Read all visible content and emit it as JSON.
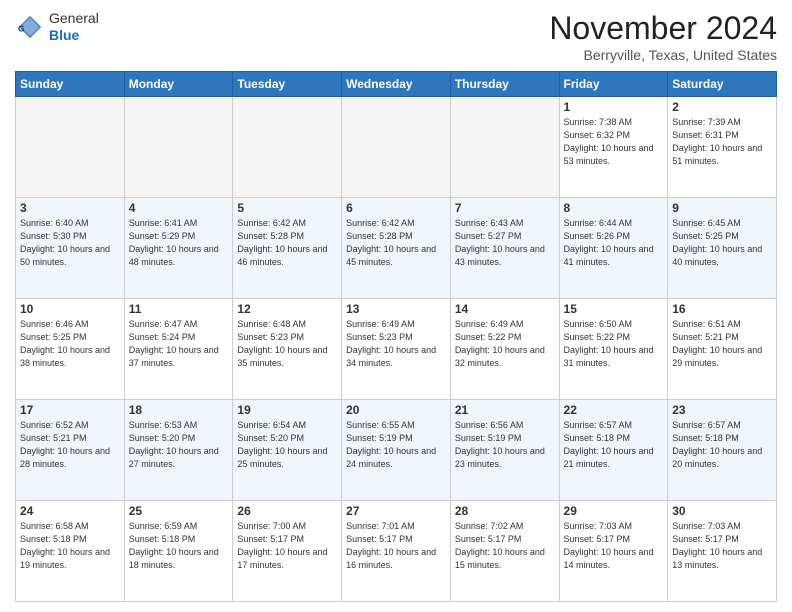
{
  "header": {
    "logo_general": "General",
    "logo_blue": "Blue",
    "month_title": "November 2024",
    "location": "Berryville, Texas, United States"
  },
  "calendar": {
    "days_of_week": [
      "Sunday",
      "Monday",
      "Tuesday",
      "Wednesday",
      "Thursday",
      "Friday",
      "Saturday"
    ],
    "weeks": [
      [
        {
          "day": "",
          "empty": true
        },
        {
          "day": "",
          "empty": true
        },
        {
          "day": "",
          "empty": true
        },
        {
          "day": "",
          "empty": true
        },
        {
          "day": "",
          "empty": true
        },
        {
          "day": "1",
          "sunrise": "7:38 AM",
          "sunset": "6:32 PM",
          "daylight": "10 hours and 53 minutes."
        },
        {
          "day": "2",
          "sunrise": "7:39 AM",
          "sunset": "6:31 PM",
          "daylight": "10 hours and 51 minutes."
        }
      ],
      [
        {
          "day": "3",
          "sunrise": "6:40 AM",
          "sunset": "5:30 PM",
          "daylight": "10 hours and 50 minutes."
        },
        {
          "day": "4",
          "sunrise": "6:41 AM",
          "sunset": "5:29 PM",
          "daylight": "10 hours and 48 minutes."
        },
        {
          "day": "5",
          "sunrise": "6:42 AM",
          "sunset": "5:28 PM",
          "daylight": "10 hours and 46 minutes."
        },
        {
          "day": "6",
          "sunrise": "6:42 AM",
          "sunset": "5:28 PM",
          "daylight": "10 hours and 45 minutes."
        },
        {
          "day": "7",
          "sunrise": "6:43 AM",
          "sunset": "5:27 PM",
          "daylight": "10 hours and 43 minutes."
        },
        {
          "day": "8",
          "sunrise": "6:44 AM",
          "sunset": "5:26 PM",
          "daylight": "10 hours and 41 minutes."
        },
        {
          "day": "9",
          "sunrise": "6:45 AM",
          "sunset": "5:25 PM",
          "daylight": "10 hours and 40 minutes."
        }
      ],
      [
        {
          "day": "10",
          "sunrise": "6:46 AM",
          "sunset": "5:25 PM",
          "daylight": "10 hours and 38 minutes."
        },
        {
          "day": "11",
          "sunrise": "6:47 AM",
          "sunset": "5:24 PM",
          "daylight": "10 hours and 37 minutes."
        },
        {
          "day": "12",
          "sunrise": "6:48 AM",
          "sunset": "5:23 PM",
          "daylight": "10 hours and 35 minutes."
        },
        {
          "day": "13",
          "sunrise": "6:49 AM",
          "sunset": "5:23 PM",
          "daylight": "10 hours and 34 minutes."
        },
        {
          "day": "14",
          "sunrise": "6:49 AM",
          "sunset": "5:22 PM",
          "daylight": "10 hours and 32 minutes."
        },
        {
          "day": "15",
          "sunrise": "6:50 AM",
          "sunset": "5:22 PM",
          "daylight": "10 hours and 31 minutes."
        },
        {
          "day": "16",
          "sunrise": "6:51 AM",
          "sunset": "5:21 PM",
          "daylight": "10 hours and 29 minutes."
        }
      ],
      [
        {
          "day": "17",
          "sunrise": "6:52 AM",
          "sunset": "5:21 PM",
          "daylight": "10 hours and 28 minutes."
        },
        {
          "day": "18",
          "sunrise": "6:53 AM",
          "sunset": "5:20 PM",
          "daylight": "10 hours and 27 minutes."
        },
        {
          "day": "19",
          "sunrise": "6:54 AM",
          "sunset": "5:20 PM",
          "daylight": "10 hours and 25 minutes."
        },
        {
          "day": "20",
          "sunrise": "6:55 AM",
          "sunset": "5:19 PM",
          "daylight": "10 hours and 24 minutes."
        },
        {
          "day": "21",
          "sunrise": "6:56 AM",
          "sunset": "5:19 PM",
          "daylight": "10 hours and 23 minutes."
        },
        {
          "day": "22",
          "sunrise": "6:57 AM",
          "sunset": "5:18 PM",
          "daylight": "10 hours and 21 minutes."
        },
        {
          "day": "23",
          "sunrise": "6:57 AM",
          "sunset": "5:18 PM",
          "daylight": "10 hours and 20 minutes."
        }
      ],
      [
        {
          "day": "24",
          "sunrise": "6:58 AM",
          "sunset": "5:18 PM",
          "daylight": "10 hours and 19 minutes."
        },
        {
          "day": "25",
          "sunrise": "6:59 AM",
          "sunset": "5:18 PM",
          "daylight": "10 hours and 18 minutes."
        },
        {
          "day": "26",
          "sunrise": "7:00 AM",
          "sunset": "5:17 PM",
          "daylight": "10 hours and 17 minutes."
        },
        {
          "day": "27",
          "sunrise": "7:01 AM",
          "sunset": "5:17 PM",
          "daylight": "10 hours and 16 minutes."
        },
        {
          "day": "28",
          "sunrise": "7:02 AM",
          "sunset": "5:17 PM",
          "daylight": "10 hours and 15 minutes."
        },
        {
          "day": "29",
          "sunrise": "7:03 AM",
          "sunset": "5:17 PM",
          "daylight": "10 hours and 14 minutes."
        },
        {
          "day": "30",
          "sunrise": "7:03 AM",
          "sunset": "5:17 PM",
          "daylight": "10 hours and 13 minutes."
        }
      ]
    ]
  }
}
